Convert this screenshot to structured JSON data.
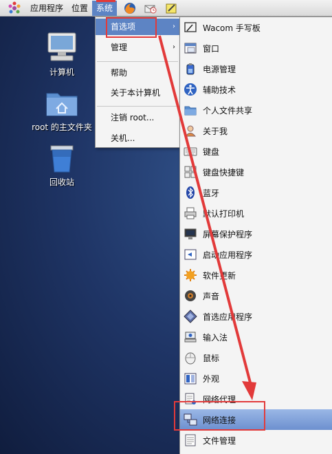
{
  "panel": {
    "menus": [
      "应用程序",
      "位置",
      "系统"
    ],
    "active_menu": "系统",
    "launchers": [
      "firefox-icon",
      "mail-clock-icon",
      "notepad-icon"
    ]
  },
  "desktop": {
    "icons": [
      {
        "label": "计算机",
        "icon": "computer-icon"
      },
      {
        "label": "root 的主文件夹",
        "icon": "home-folder-icon"
      },
      {
        "label": "回收站",
        "icon": "trash-icon"
      }
    ]
  },
  "system_menu": {
    "items": [
      {
        "label": "首选项",
        "submenu": true,
        "highlighted": true
      },
      {
        "label": "管理",
        "submenu": true
      },
      {
        "label": "帮助"
      },
      {
        "label": "关于本计算机"
      },
      {
        "label": "注销 root..."
      },
      {
        "label": "关机..."
      }
    ],
    "submenu_arrow": "›"
  },
  "preferences_menu": {
    "items": [
      {
        "label": "Wacom 手写板",
        "icon": "tablet-icon"
      },
      {
        "label": "窗口",
        "icon": "window-icon"
      },
      {
        "label": "电源管理",
        "icon": "power-icon"
      },
      {
        "label": "辅助技术",
        "icon": "accessibility-icon"
      },
      {
        "label": "个人文件共享",
        "icon": "file-share-icon"
      },
      {
        "label": "关于我",
        "icon": "about-me-icon"
      },
      {
        "label": "键盘",
        "icon": "keyboard-icon"
      },
      {
        "label": "键盘快捷键",
        "icon": "keyboard-shortcuts-icon"
      },
      {
        "label": "蓝牙",
        "icon": "bluetooth-icon"
      },
      {
        "label": "默认打印机",
        "icon": "printer-icon"
      },
      {
        "label": "屏幕保护程序",
        "icon": "screensaver-icon"
      },
      {
        "label": "启动应用程序",
        "icon": "startup-apps-icon"
      },
      {
        "label": "软件更新",
        "icon": "software-update-icon"
      },
      {
        "label": "声音",
        "icon": "sound-icon"
      },
      {
        "label": "首选应用程序",
        "icon": "preferred-apps-icon"
      },
      {
        "label": "输入法",
        "icon": "input-method-icon"
      },
      {
        "label": "鼠标",
        "icon": "mouse-icon"
      },
      {
        "label": "外观",
        "icon": "appearance-icon"
      },
      {
        "label": "网络代理",
        "icon": "network-proxy-icon"
      },
      {
        "label": "网络连接",
        "icon": "network-connections-icon",
        "highlighted": true
      },
      {
        "label": "文件管理",
        "icon": "file-management-icon"
      }
    ]
  },
  "colors": {
    "menu_highlight": "#5d84c4",
    "annotation_red": "#e23a3a",
    "desktop_bg": "#1f3566"
  }
}
